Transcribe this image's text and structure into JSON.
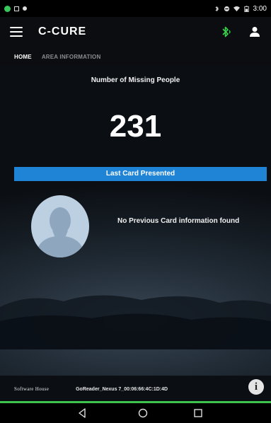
{
  "status_bar": {
    "time": "3:00"
  },
  "toolbar": {
    "brand": "C-CURE"
  },
  "tabs": [
    {
      "label": "HOME",
      "active": true
    },
    {
      "label": "AREA INFORMATION",
      "active": false
    }
  ],
  "main": {
    "missing_label": "Number of Missing People",
    "missing_count": "231",
    "last_card_label": "Last Card Presented",
    "no_card_message": "No Previous Card information found"
  },
  "footer": {
    "company": "Software House",
    "reader_id": "GoReader_Nexus 7_00:06:66:4C:1D:4D",
    "info_label": "i"
  },
  "colors": {
    "accent_blue": "#1f84d6",
    "bluetooth_green": "#37d14a",
    "footer_line_green": "#3ec44a"
  }
}
